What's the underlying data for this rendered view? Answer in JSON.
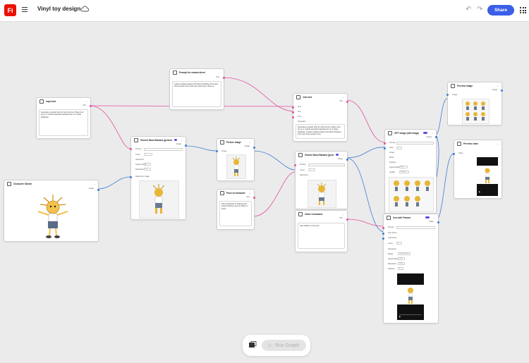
{
  "app": {
    "logo_text": "Fi",
    "document_title": "Vinyl toy design",
    "share_label": "Share",
    "run_label": "Run Graph"
  },
  "colors": {
    "accent": "#3a5ee8",
    "text_wire": "#e24fa0",
    "image_wire": "#3b7bd6",
    "toggle": "#5a4ee6",
    "logo": "#eb1000"
  },
  "nodes": {
    "input_text": {
      "title": "Input text",
      "out_label": "Text",
      "content": "Generate a product shot for soft vinyl toy. Place vinyl toy on a neutral seamless background, on a white backdrop."
    },
    "prompt_for_variant": {
      "title": "Prompt for variant sheet",
      "out_label": "Text",
      "content": "Create multiple Angles of Product including: front view, three-quarter view, side view, back view, close up"
    },
    "character_sketch": {
      "title": "Character Sketch",
      "out_label": "Image"
    },
    "gemini_1": {
      "title": "Gemini Nano Banana (generate image)",
      "out_label": "Image",
      "in_label": "Prompt",
      "count_label": "Count",
      "count_value": "1",
      "advanced": "Advanced",
      "aspect_label": "Aspect Ratio",
      "aspect_value": "1:1",
      "resolution_label": "Resolution",
      "resolution_value": "1K",
      "ref_label": "Reference image"
    },
    "picture_image": {
      "title": "Picture image",
      "out_label": "Image",
      "in_label": "Image"
    },
    "pose_of_character": {
      "title": "Pose of character",
      "out_label": "Text",
      "content": "Pose Character as defined and posed holding a cup of coffee on hand"
    },
    "join_text": {
      "title": "Join text",
      "out_label": "Text",
      "in1": "Text",
      "in2": "Text",
      "in3": "Text",
      "sep_label": "Separator",
      "content": "Generate a product shot for soft vinyl toy. Place vinyl toy on a neutral seamless background, on a white backdrop. Create multiple Angles of Product including front view three quarter view"
    },
    "gemini_2": {
      "title": "Gemini Nano Banana (generate image)",
      "out_label": "Image",
      "in_label": "Prompt",
      "count_label": "Count",
      "count_value": "1",
      "advanced": "Advanced"
    },
    "video_command": {
      "title": "Video Command",
      "out_label": "Text",
      "content": "slow rotation of vinyl toy"
    },
    "gpt_image": {
      "title": "GPT Image (edit image)",
      "out_label": "Output",
      "prompt_label": "Prompt",
      "input_label": "Input",
      "image_label": "Image",
      "mask_label": "Mask",
      "settings": "Settings",
      "aspect_label": "Aspect Ratio",
      "aspect_value": "Auto",
      "quality_label": "Quality",
      "quality_value": "Medium"
    },
    "veo": {
      "title": "Veo with Frames",
      "out_label": "Video",
      "prompt_label": "Prompt",
      "first_label": "First frame",
      "last_label": "Last frame",
      "count_label": "Count",
      "advanced": "Advanced",
      "model_label": "Model",
      "model_value": "Veo generate",
      "aspect_label": "Aspect Ratio",
      "aspect_value": "16:9",
      "resolution_label": "Resolution",
      "resolution_value": "720p",
      "duration_label": "Duration",
      "duration_value": "8"
    },
    "preview_image": {
      "title": "Preview image",
      "out_label": "Image",
      "in_label": "Image"
    },
    "preview_video": {
      "title": "Preview video",
      "in_label": "Video"
    }
  }
}
